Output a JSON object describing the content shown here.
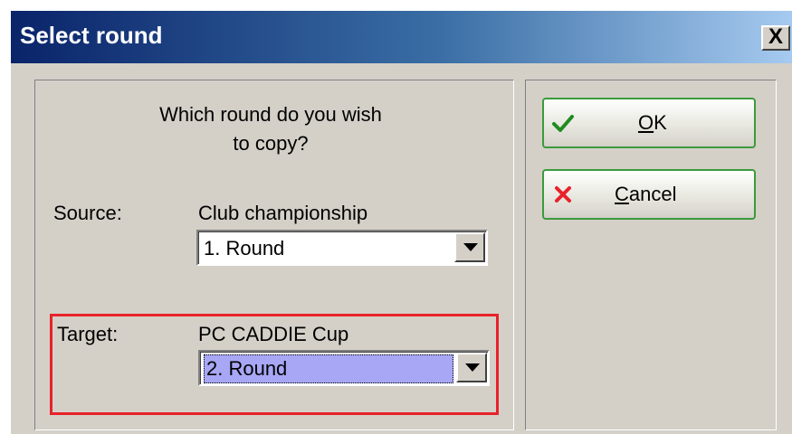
{
  "dialog": {
    "title": "Select round",
    "close_label": "X"
  },
  "question": {
    "line1": "Which round do you wish",
    "line2": "to copy?"
  },
  "source": {
    "label": "Source:",
    "competition": "Club championship",
    "round_value": "1. Round"
  },
  "target": {
    "label": "Target:",
    "competition": "PC CADDIE Cup",
    "round_value": "2. Round"
  },
  "buttons": {
    "ok": {
      "mnemonic": "O",
      "rest": "K"
    },
    "cancel": {
      "mnemonic": "C",
      "rest": "ancel"
    }
  },
  "icons": {
    "ok": "check-icon",
    "cancel": "x-icon"
  },
  "colors": {
    "highlight_border": "#e8222a",
    "selection_background": "#a7a7f5",
    "button_border": "#3c9a3c",
    "title_gradient_start": "#0a246a",
    "title_gradient_end": "#a6caf0"
  }
}
